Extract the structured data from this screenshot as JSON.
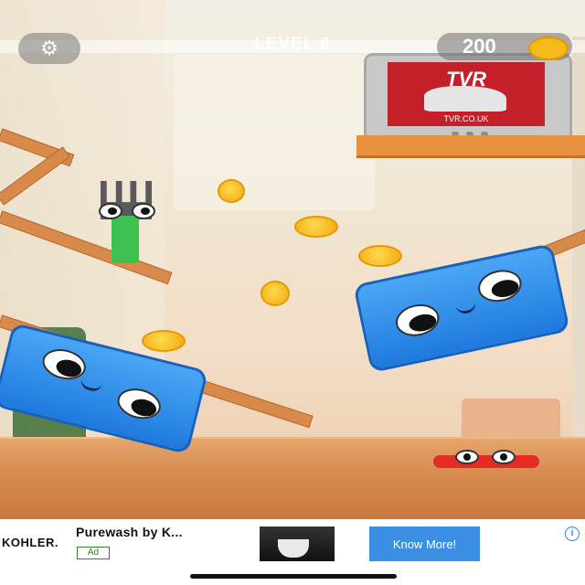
{
  "hud": {
    "settings_icon": "gear-icon",
    "level": "LEVEL 8",
    "coins": "200",
    "coin_icon": "coin-icon"
  },
  "tv": {
    "brand": "TVR",
    "url": "TVR.CO.UK"
  },
  "ad": {
    "brand": "KOHLER.",
    "title": "Purewash by K...",
    "tag": "Ad",
    "cta": "Know More!",
    "info_icon": "i"
  },
  "colors": {
    "toaster": "#2f8ff0",
    "coin": "#f6b91d",
    "cta": "#3b8fe3",
    "shelf": "#e8913f"
  }
}
